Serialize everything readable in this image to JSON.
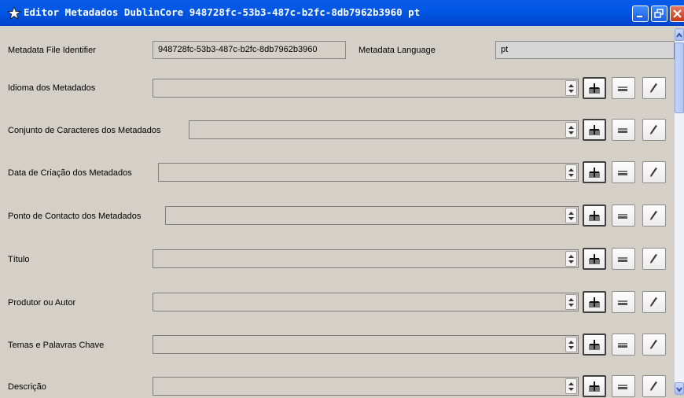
{
  "window": {
    "title": "Editor Metadados DublinCore 948728fc-53b3-487c-b2fc-8db7962b3960 pt",
    "icon": "star-icon"
  },
  "header": {
    "file_identifier_label": "Metadata File Identifier",
    "file_identifier_value": "948728fc-53b3-487c-b2fc-8db7962b3960",
    "language_label": "Metadata Language",
    "language_value": "pt"
  },
  "fields": [
    {
      "label": "Idioma dos Metadados",
      "value": ""
    },
    {
      "label": "Conjunto de Caracteres dos Metadados",
      "value": ""
    },
    {
      "label": "Data de Criação dos Metadados",
      "value": ""
    },
    {
      "label": "Ponto de Contacto dos Metadados",
      "value": ""
    },
    {
      "label": "Título",
      "value": ""
    },
    {
      "label": "Produtor ou Autor",
      "value": ""
    },
    {
      "label": "Temas e Palavras Chave",
      "value": ""
    },
    {
      "label": "Descrição",
      "value": ""
    }
  ],
  "row_actions": [
    "add-icon",
    "remove-icon",
    "edit-icon"
  ],
  "colors": {
    "titlebar": "#0058e6",
    "panel": "#d4d0c8",
    "close": "#c4381c"
  }
}
